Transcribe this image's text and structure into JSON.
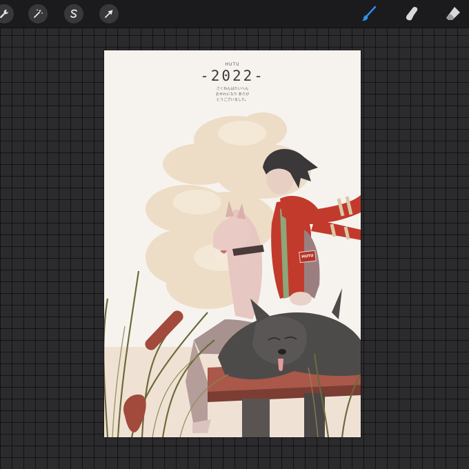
{
  "toolbar": {
    "left_tools": [
      {
        "name": "actions",
        "icon": "wrench-icon"
      },
      {
        "name": "adjustments",
        "icon": "magic-wand-icon"
      },
      {
        "name": "selection",
        "icon": "selection-s-icon"
      },
      {
        "name": "transform",
        "icon": "arrow-cursor-icon"
      }
    ],
    "right_tools": [
      {
        "name": "brush",
        "icon": "brush-icon",
        "active": true,
        "color": "#2f8ff0"
      },
      {
        "name": "smudge",
        "icon": "smudge-finger-icon",
        "active": false
      },
      {
        "name": "eraser",
        "icon": "eraser-icon",
        "active": false
      }
    ]
  },
  "artwork": {
    "signature": "HUTU",
    "year": "-2022-",
    "message_lines": [
      "さくねんはたいへん",
      "おせわになり ありが",
      "とうございました。"
    ],
    "armband": "HUTU"
  },
  "colors": {
    "background": "#2b2b2d",
    "toolbar": "#1b1b1d",
    "canvas": "#f6f3ef",
    "accent": "#2f8ff0",
    "scarf_red": "#c23a2c"
  }
}
